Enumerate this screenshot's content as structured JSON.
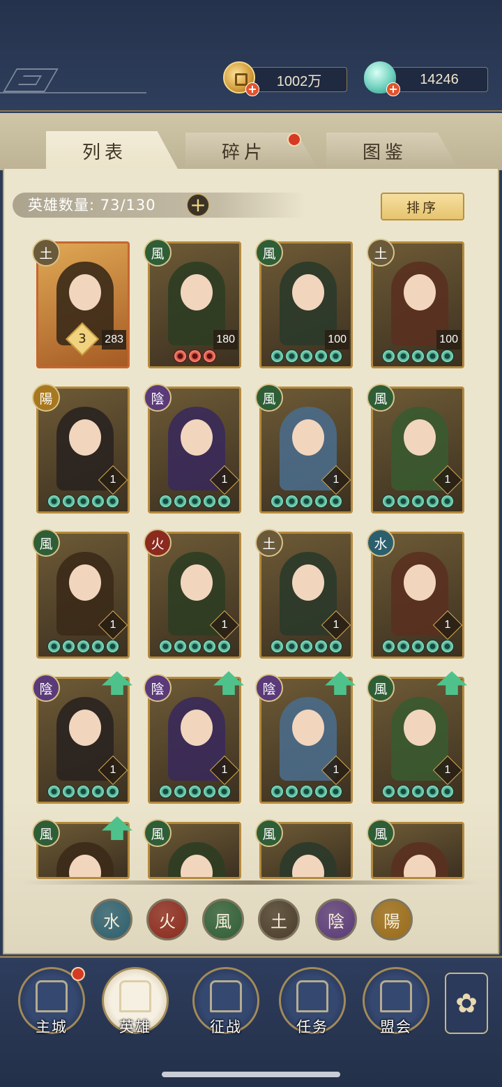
{
  "currencies": [
    {
      "name": "coin",
      "icon": "copper-coin-icon",
      "value": "1002万"
    },
    {
      "name": "jade",
      "icon": "jade-shell-icon",
      "value": "14246"
    }
  ],
  "tabs": [
    {
      "label": "列表",
      "active": true
    },
    {
      "label": "碎片",
      "active": false,
      "has_notification": true
    },
    {
      "label": "图鉴",
      "active": false
    }
  ],
  "hero_count": {
    "label": "英雄数量: 73/130"
  },
  "sort_button": {
    "label": "排序"
  },
  "heroes": [
    {
      "faction": "土",
      "level": "283",
      "rank": "3",
      "stars": 0,
      "red_stars": 0,
      "style": "gold"
    },
    {
      "faction": "風",
      "level": "180",
      "stars": 0,
      "red_stars": 3
    },
    {
      "faction": "風",
      "level": "100",
      "stars": 5,
      "red_stars": 0
    },
    {
      "faction": "土",
      "level": "100",
      "stars": 5,
      "red_stars": 0
    },
    {
      "faction": "陽",
      "level": "1",
      "stars": 5
    },
    {
      "faction": "陰",
      "level": "1",
      "stars": 5
    },
    {
      "faction": "風",
      "level": "1",
      "stars": 5
    },
    {
      "faction": "風",
      "level": "1",
      "stars": 5
    },
    {
      "faction": "風",
      "level": "1",
      "stars": 5
    },
    {
      "faction": "火",
      "level": "1",
      "stars": 5
    },
    {
      "faction": "土",
      "level": "1",
      "stars": 5
    },
    {
      "faction": "水",
      "level": "1",
      "stars": 5
    },
    {
      "faction": "陰",
      "level": "1",
      "stars": 5,
      "upgradable": true
    },
    {
      "faction": "陰",
      "level": "1",
      "stars": 5,
      "upgradable": true
    },
    {
      "faction": "陰",
      "level": "1",
      "stars": 5,
      "upgradable": true
    },
    {
      "faction": "風",
      "level": "1",
      "stars": 5,
      "upgradable": true
    },
    {
      "faction": "風",
      "upgradable": true
    },
    {
      "faction": "風"
    },
    {
      "faction": "風"
    },
    {
      "faction": "風"
    }
  ],
  "faction_filters": [
    {
      "label": "水",
      "color": "#2c5f6e"
    },
    {
      "label": "火",
      "color": "#8b2a1e"
    },
    {
      "label": "風",
      "color": "#2f5e36"
    },
    {
      "label": "土",
      "color": "#4a3d2a"
    },
    {
      "label": "陰",
      "color": "#5a3a78"
    },
    {
      "label": "陽",
      "color": "#9a6b18"
    }
  ],
  "nav": [
    {
      "label": "主城",
      "icon": "city-gate-icon",
      "has_notification": true
    },
    {
      "label": "英雄",
      "icon": "hero-portrait-icon",
      "active": true
    },
    {
      "label": "征战",
      "icon": "battle-banner-icon"
    },
    {
      "label": "任务",
      "icon": "scroll-task-icon"
    },
    {
      "label": "盟会",
      "icon": "alliance-pavilion-icon"
    }
  ],
  "more_menu": {
    "icon": "four-petal-menu-icon",
    "glyph": "✿"
  },
  "faction_colors": {
    "土": "#6b5a3a",
    "風": "#2f5e36",
    "陽": "#a8781e",
    "陰": "#5a3a78",
    "火": "#8b2a1e",
    "水": "#2c5f6e"
  },
  "hero_palette": [
    "#3b2a18",
    "#2e3d22",
    "#2b3a2a",
    "#5a3020",
    "#2a2420",
    "#3a2a5a",
    "#4a6b8a",
    "#3a5a30"
  ]
}
